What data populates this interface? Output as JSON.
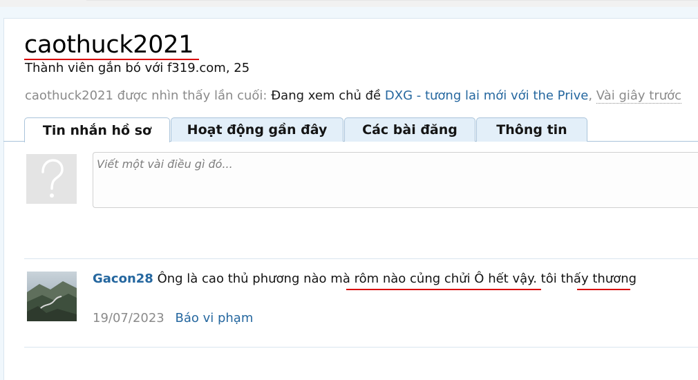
{
  "profile": {
    "username": "caothuck2021",
    "subtitle": "Thành viên gắn bó với f319.com, 25",
    "last_seen": {
      "prefix": "caothuck2021 được nhìn thấy lần cuối:",
      "action": "Đang xem chủ đề",
      "thread_link": "DXG - tương lai mới với the Prive",
      "comma": ",",
      "time": "Vài giây trước"
    }
  },
  "tabs": [
    {
      "label": "Tin nhắn hồ sơ",
      "active": true
    },
    {
      "label": "Hoạt động gần đây",
      "active": false
    },
    {
      "label": "Các bài đăng",
      "active": false
    },
    {
      "label": "Thông tin",
      "active": false
    }
  ],
  "status_input": {
    "placeholder": "Viết một vài điều gì đó..."
  },
  "messages": [
    {
      "author": "Gacon28",
      "text": "Ông là cao thủ phương nào mà rôm nào củng chửi Ô hết vậy. tôi thấy thương",
      "date": "19/07/2023",
      "report_label": "Báo vi phạm"
    }
  ],
  "colors": {
    "link": "#25679f",
    "tab_bg": "#e3eff9",
    "annotation_red": "#d80000"
  }
}
